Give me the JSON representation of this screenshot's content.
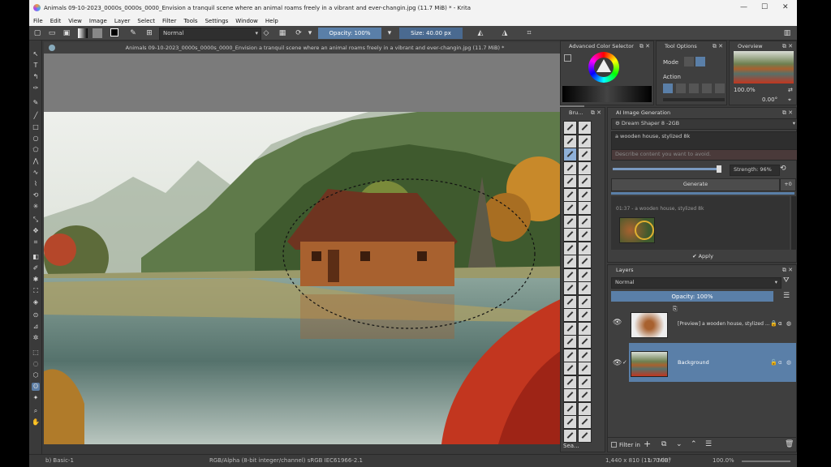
{
  "window": {
    "title": "Animals 09-10-2023_0000s_0000s_0000_Envision a tranquil scene where an animal roams freely in a vibrant and ever-changin.jpg (11.7 MiB) * - Krita",
    "controls": [
      "—",
      "☐",
      "✕"
    ]
  },
  "menu": [
    "File",
    "Edit",
    "View",
    "Image",
    "Layer",
    "Select",
    "Filter",
    "Tools",
    "Settings",
    "Window",
    "Help"
  ],
  "toolbar": {
    "blend_mode": "Normal",
    "opacity": "Opacity: 100%",
    "size": "Size: 40.00 px"
  },
  "document": {
    "tab_title": "Animals 09-10-2023_0000s_0000s_0000_Envision a tranquil scene where an animal roams freely in a vibrant and ever-changin.jpg (11.7 MiB) *"
  },
  "panels": {
    "color_selector": {
      "title": "Advanced Color Selector"
    },
    "tool_options": {
      "title": "Tool Options",
      "mode_label": "Mode",
      "action_label": "Action"
    },
    "overview": {
      "title": "Overview",
      "zoom": "100.0%",
      "rotation": "0.00°"
    },
    "brushes": {
      "title": "Bru..."
    },
    "ai_generation": {
      "title": "AI Image Generation",
      "model": "Dream Shaper 8 -2GB",
      "prompt": "a wooden house, stylized 8k",
      "negative_placeholder": "Describe content you want to avoid.",
      "strength": "Strength: 96%",
      "generate_label": "Generate",
      "count": "+0",
      "history_label": "01:37 - a wooden house, stylized 8k",
      "apply_label": "Apply"
    },
    "layers": {
      "title": "Layers",
      "blend_mode": "Normal",
      "opacity": "Opacity: 100%",
      "items": [
        {
          "name": "[Preview] a wooden house, stylized ...",
          "selected": false
        },
        {
          "name": "Background",
          "selected": true
        }
      ],
      "filter_label": "Filter in",
      "brush_search": "Sea..."
    }
  },
  "status": {
    "brush": "b) Basic-1",
    "color_info": "RGB/Alpha (8-bit integer/channel)  sRGB IEC61966-2.1",
    "dimensions": "1,440 x 810 (11.7 MiB)",
    "rotation": "0.00°",
    "zoom": "100.0%"
  },
  "colors": {
    "accent": "#5a7fa8",
    "panel": "#3f3f3f",
    "dark": "#2e2e2e"
  }
}
